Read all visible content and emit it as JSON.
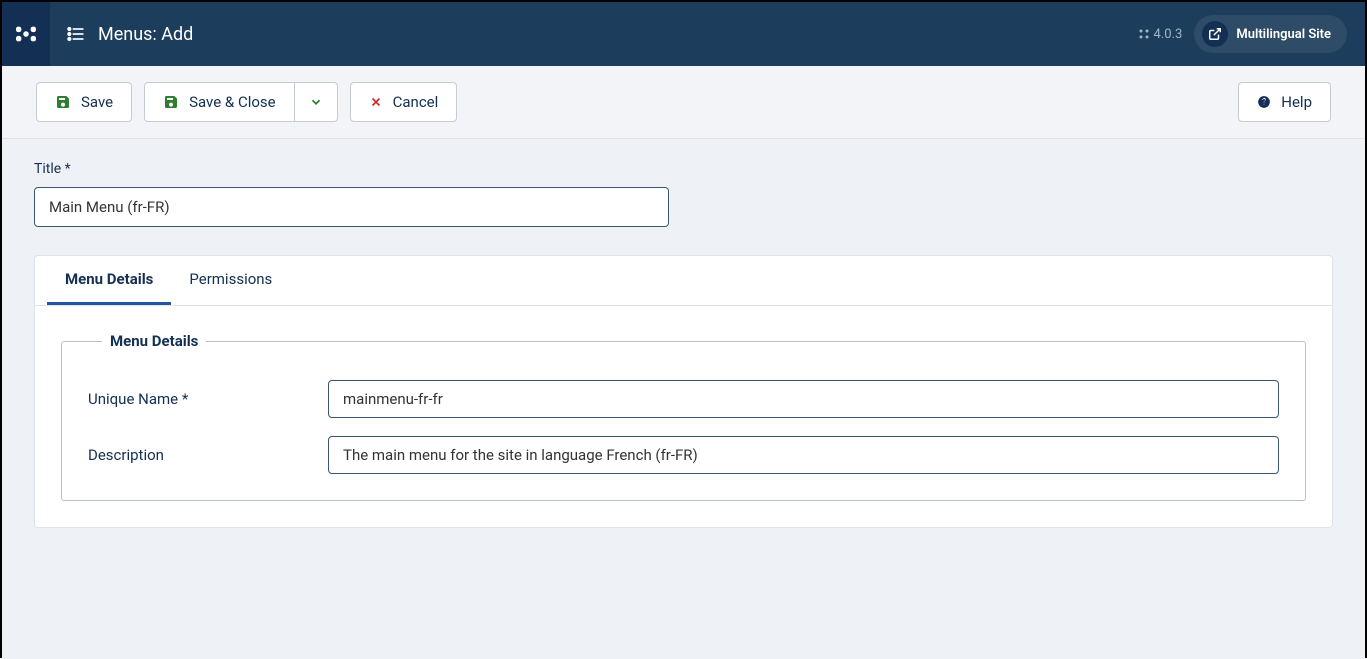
{
  "header": {
    "page_title": "Menus: Add",
    "version": "4.0.3",
    "site_name": "Multilingual Site"
  },
  "toolbar": {
    "save_label": "Save",
    "save_close_label": "Save & Close",
    "cancel_label": "Cancel",
    "help_label": "Help"
  },
  "form": {
    "title_label": "Title *",
    "title_value": "Main Menu (fr-FR)"
  },
  "tabs": {
    "menu_details": "Menu Details",
    "permissions": "Permissions"
  },
  "fieldset": {
    "legend": "Menu Details",
    "unique_name_label": "Unique Name *",
    "unique_name_value": "mainmenu-fr-fr",
    "description_label": "Description",
    "description_value": "The main menu for the site in language French (fr-FR)"
  }
}
